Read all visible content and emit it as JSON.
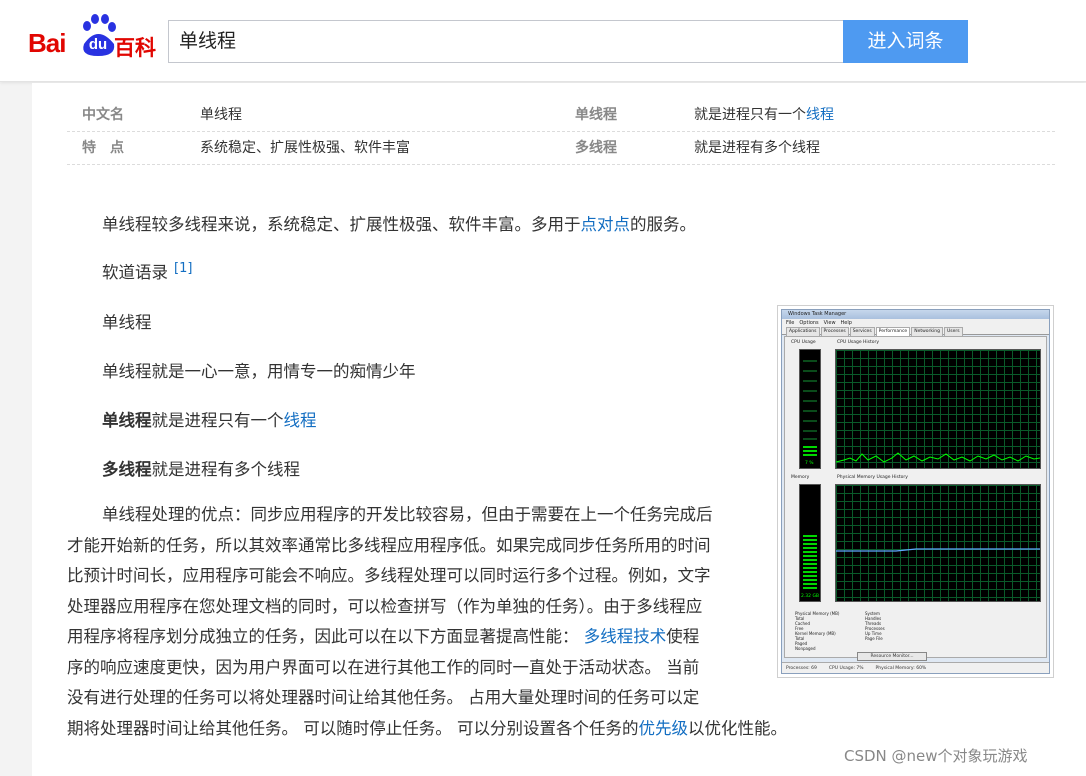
{
  "header": {
    "logo_bai": "Bai",
    "logo_du": "du",
    "logo_baike": "百科",
    "search_value": "单线程",
    "search_button": "进入词条"
  },
  "info_table": [
    {
      "k1": "中文名",
      "v1": "单线程",
      "k2": "单线程",
      "v2_prefix": "就是进程只有一个",
      "v2_link": "线程"
    },
    {
      "k1": "特　点",
      "v1": "系统稳定、扩展性极强、软件丰富",
      "k2": "多线程",
      "v2_prefix": "就是进程有多个线程",
      "v2_link": ""
    }
  ],
  "paragraphs": {
    "p1_prefix": "单线程较多线程来说，系统稳定、扩展性极强、软件丰富。多用于",
    "p1_link": "点对点",
    "p1_suffix": "的服务。",
    "p2_text": "软道语录",
    "p2_sup": "[1]",
    "p3_text": "单线程",
    "p4_text": "单线程就是一心一意，用情专一的痴情少年",
    "p5_bold": "单线程",
    "p5_text": "就是进程只有一个",
    "p5_link": "线程",
    "p6_bold": "多线程",
    "p6_text": "就是进程有多个线程"
  },
  "long_paragraph": {
    "line1": "单线程处理的优点：同步应用程序的开发比较容易，但由于需要在上一个任务完成后",
    "line2": "才能开始新的任务，所以其效率通常比多线程应用程序低。如果完成同步任务所用的时间",
    "line3": "比预计时间长，应用程序可能会不响应。多线程处理可以同时运行多个过程。例如，文字",
    "line4": "处理器应用程序在您处理文档的同时，可以检查拼写（作为单独的任务）。由于多线程应",
    "line5_prefix": "用程序将程序划分成独立的任务，因此可以在以下方面显著提高性能：",
    "line5_link": "多线程技术",
    "line5_suffix": "使程",
    "line6": "序的响应速度更快，因为用户界面可以在进行其他工作的同时一直处于活动状态。 当前",
    "line7": "没有进行处理的任务可以将处理器时间让给其他任务。 占用大量处理时间的任务可以定",
    "line8_prefix": "期将处理器时间让给其他任务。 可以随时停止任务。 可以分别设置各个任务的",
    "line8_link": "优先级",
    "line8_suffix": "以优化性能。"
  },
  "task_manager": {
    "title": "Windows Task Manager",
    "menu": [
      "File",
      "Options",
      "View",
      "Help"
    ],
    "tabs": [
      "Applications",
      "Processes",
      "Services",
      "Performance",
      "Networking",
      "Users"
    ],
    "active_tab": "Performance",
    "cpu_usage_label": "CPU Usage",
    "cpu_history_label": "CPU Usage History",
    "memory_label": "Memory",
    "memory_history_label": "Physical Memory Usage History",
    "cpu_percent": "7 %",
    "memory_value": "2.32 GB",
    "stats_left": [
      "Physical Memory (MB)",
      "Total",
      "Cached",
      "Free",
      "Kernel Memory (MB)",
      "Total",
      "Paged",
      "Nonpaged"
    ],
    "stats_right": [
      "System",
      "Handles",
      "Threads",
      "Processes",
      "Up Time",
      "Page File"
    ],
    "resource_button": "Resource Monitor...",
    "status": [
      "Processes: 69",
      "CPU Usage: 7%",
      "Physical Memory: 60%"
    ]
  },
  "watermark": "CSDN @new个对象玩游戏"
}
